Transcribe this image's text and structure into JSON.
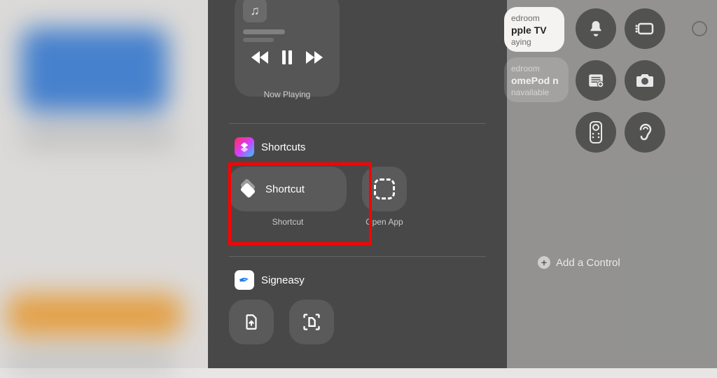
{
  "nowPlaying": {
    "label": "Now Playing"
  },
  "sections": {
    "shortcuts": {
      "title": "Shortcuts",
      "items": [
        {
          "label": "Shortcut",
          "caption": "Shortcut"
        },
        {
          "caption": "Open App"
        }
      ]
    },
    "signeasy": {
      "title": "Signeasy"
    }
  },
  "rightPane": {
    "devices": [
      {
        "room": "edroom",
        "name": "pple TV",
        "status": "aying"
      },
      {
        "room": "edroom",
        "name": "omePod n",
        "status": "navailable"
      }
    ],
    "addControl": "Add a Control"
  }
}
